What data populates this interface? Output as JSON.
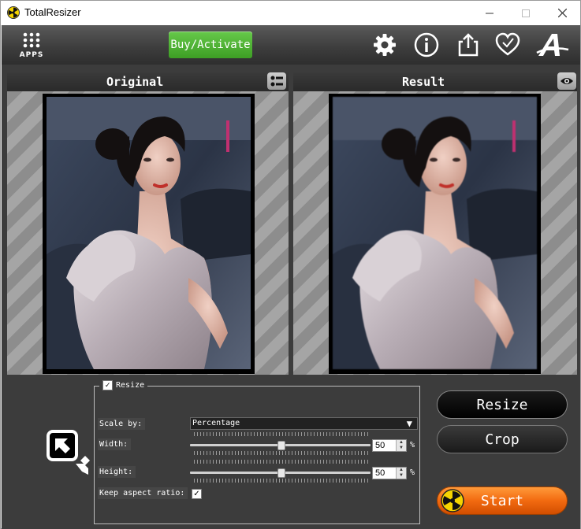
{
  "window": {
    "title": "TotalResizer"
  },
  "toolbar": {
    "apps_label": "APPS",
    "buy_label": "Buy/Activate",
    "icons": [
      "gear-icon",
      "info-icon",
      "share-icon",
      "heart-icon",
      "font-a-icon"
    ]
  },
  "panels": {
    "original_title": "Original",
    "result_title": "Result"
  },
  "resize": {
    "group_label": "Resize",
    "group_checked": true,
    "scale_by_label": "Scale by:",
    "scale_by_value": "Percentage",
    "width_label": "Width:",
    "width_value": "50",
    "width_unit": "%",
    "height_label": "Height:",
    "height_value": "50",
    "height_unit": "%",
    "keep_aspect_label": "Keep aspect ratio:",
    "keep_aspect_checked": true
  },
  "actions": {
    "resize_label": "Resize",
    "crop_label": "Crop",
    "start_label": "Start"
  },
  "colors": {
    "buy_green": "#4caf32",
    "start_orange": "#f26a10",
    "dark_bg": "#3c3c3c"
  }
}
